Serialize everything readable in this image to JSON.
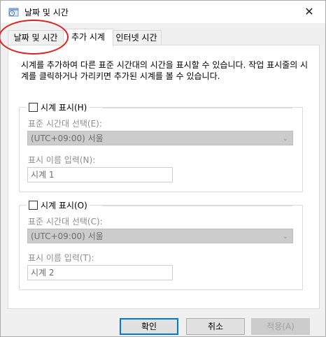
{
  "window": {
    "title": "날짜 및 시간",
    "close_glyph": "✕"
  },
  "tabs": [
    {
      "label": "날짜 및 시간",
      "active": false
    },
    {
      "label": "추가 시계",
      "active": true
    },
    {
      "label": "인터넷 시간",
      "active": false
    }
  ],
  "description": "시계를 추가하여 다른 표준 시간대의 시간을 표시할 수 있습니다. 작업 표시줄의 시계를 클릭하거나 가리키면 추가된 시계를 볼 수 있습니다.",
  "clock1": {
    "show_label": "시계 표시(H)",
    "checked": false,
    "timezone_label": "표준 시간대 선택(E):",
    "timezone_value": "(UTC+09:00) 서울",
    "name_label": "표시 이름 입력(N):",
    "name_value": "시계 1"
  },
  "clock2": {
    "show_label": "시계 표시(O)",
    "checked": false,
    "timezone_label": "표준 시간대 선택(C):",
    "timezone_value": "(UTC+09:00) 서울",
    "name_label": "표시 이름 입력(T):",
    "name_value": "시계 2"
  },
  "buttons": {
    "ok": "확인",
    "cancel": "취소",
    "apply": "적용(A)"
  },
  "colors": {
    "annotation": "#e02020",
    "accent": "#0078d7"
  }
}
